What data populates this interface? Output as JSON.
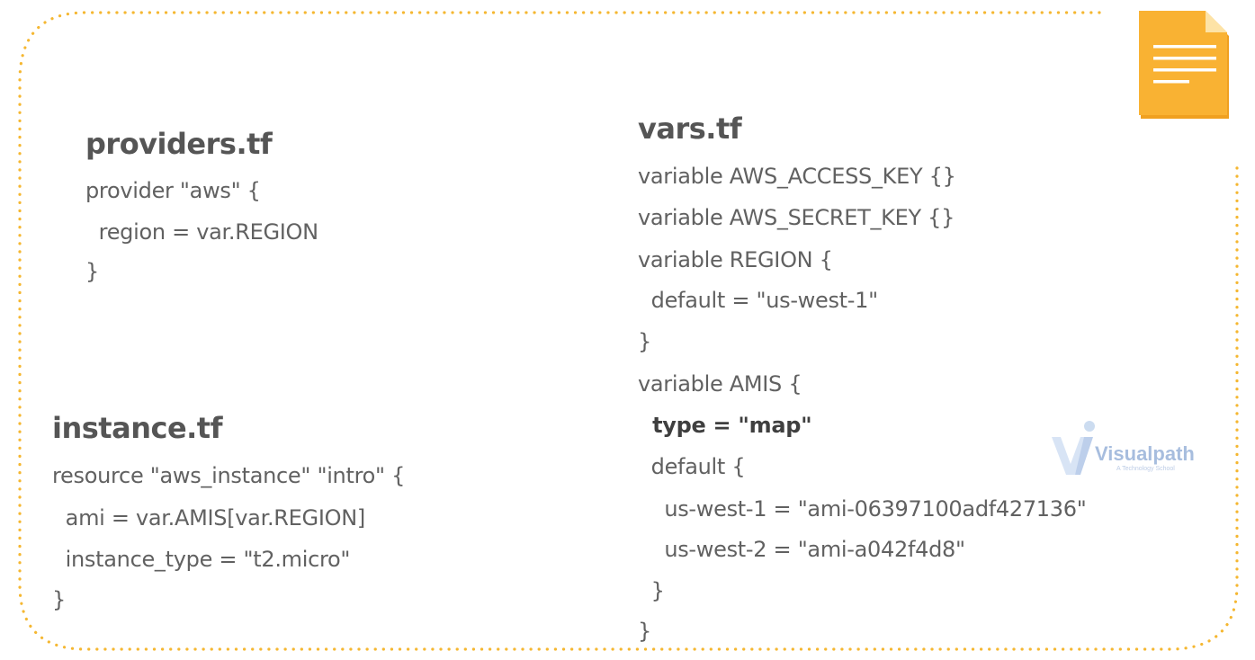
{
  "providers": {
    "title": "providers.tf",
    "lines": [
      "provider \"aws\" {",
      "  region = var.REGION",
      "}"
    ]
  },
  "vars": {
    "title": "vars.tf",
    "lines": [
      "variable AWS_ACCESS_KEY {}",
      "variable AWS_SECRET_KEY {}",
      "variable REGION {",
      "  default = \"us-west-1\"",
      "}",
      "variable AMIS {",
      "  type = \"map\"",
      "  default {",
      "    us-west-1 = \"ami-06397100adf427136\"",
      "    us-west-2 = \"ami-a042f4d8\"",
      "  }",
      "}"
    ]
  },
  "instance": {
    "title": "instance.tf",
    "lines": [
      "resource \"aws_instance\" \"intro\" {",
      "  ami = var.AMIS[var.REGION]",
      "  instance_type = \"t2.micro\"",
      "}"
    ]
  },
  "watermark": {
    "name": "Visualpath",
    "tagline": "A Technology School"
  },
  "colors": {
    "border_dots": "#f5b731",
    "doc_icon": "#f9b233",
    "heading": "#555555",
    "code": "#616161"
  },
  "icons": {
    "document": "document-icon",
    "watermark_logo": "visualpath-logo-icon"
  }
}
